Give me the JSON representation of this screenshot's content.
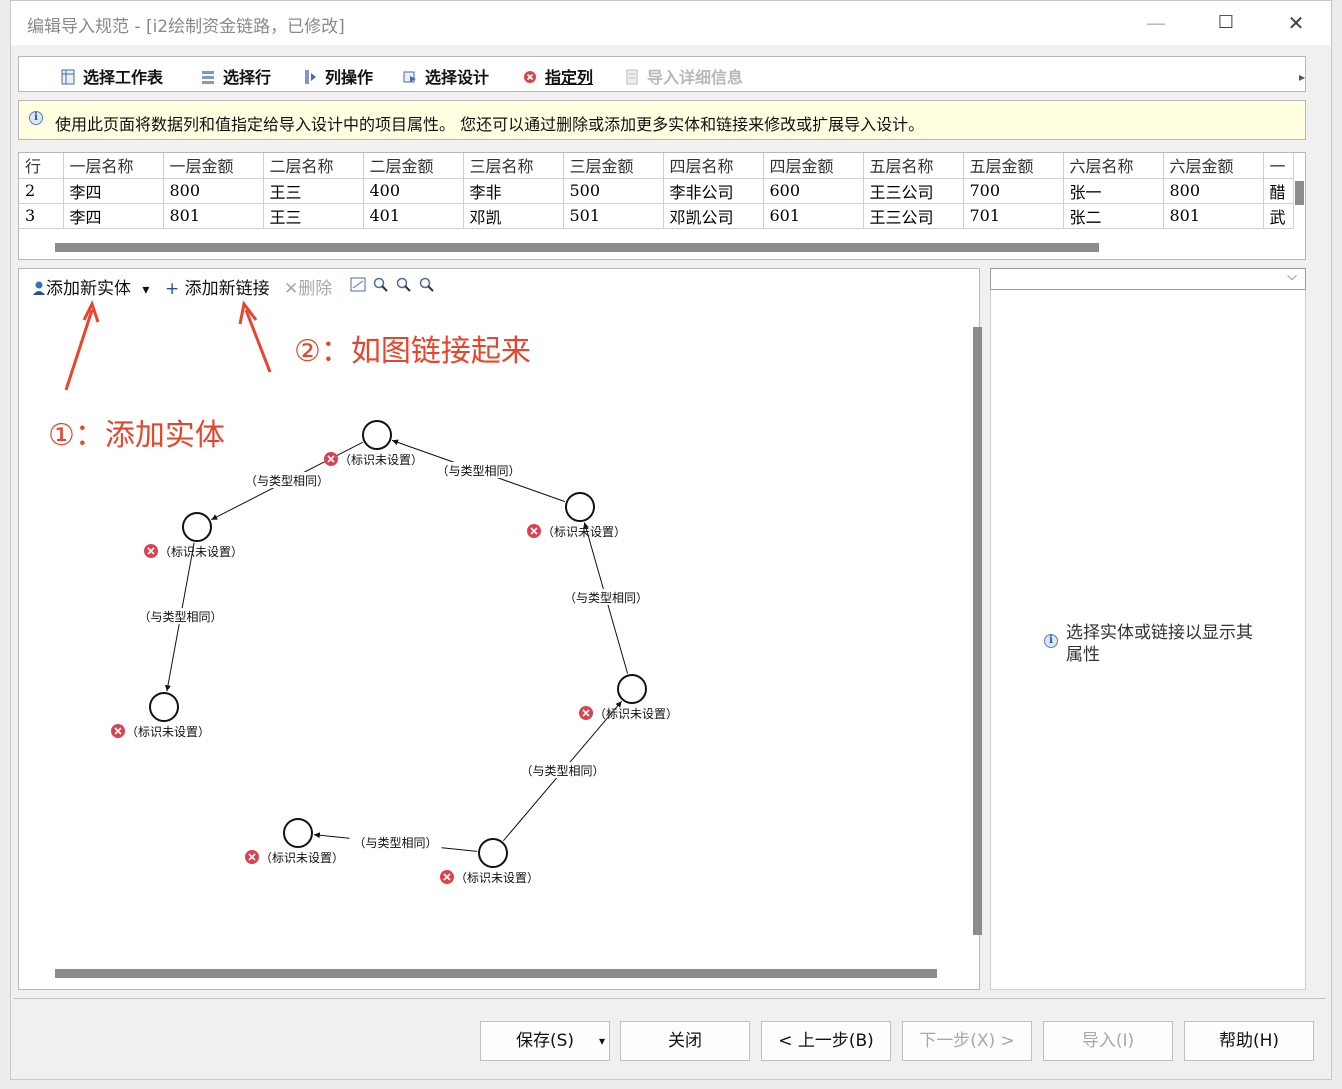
{
  "window": {
    "title": "编辑导入规范 - [i2绘制资金链路，已修改]"
  },
  "window_controls": {
    "minimize": "—",
    "maximize": "☐",
    "close": "✕"
  },
  "tabs": [
    {
      "label": "选择工作表",
      "icon": "worksheet-icon"
    },
    {
      "label": "选择行",
      "icon": "rows-icon"
    },
    {
      "label": "列操作",
      "icon": "column-op-icon"
    },
    {
      "label": "选择设计",
      "icon": "design-icon"
    },
    {
      "label": "指定列",
      "icon": "error-icon",
      "active": true
    },
    {
      "label": "导入详细信息",
      "icon": "details-icon",
      "disabled": true
    }
  ],
  "tab_nav": {
    "left": "◂",
    "right": "▸"
  },
  "info_message": "使用此页面将数据列和值指定给导入设计中的项目属性。 您还可以通过删除或添加更多实体和链接来修改或扩展导入设计。",
  "grid": {
    "headers": [
      "行",
      "一层名称",
      "一层金额",
      "二层名称",
      "二层金额",
      "三层名称",
      "三层金额",
      "四层名称",
      "四层金额",
      "五层名称",
      "五层金额",
      "六层名称",
      "六层金额",
      "一"
    ],
    "rows": [
      [
        "2",
        "李四",
        "800",
        "王三",
        "400",
        "李非",
        "500",
        "李非公司",
        "600",
        "王三公司",
        "700",
        "张一",
        "800",
        "醋"
      ],
      [
        "3",
        "李四",
        "801",
        "王三",
        "401",
        "邓凯",
        "501",
        "邓凯公司",
        "601",
        "王三公司",
        "701",
        "张二",
        "801",
        "武"
      ]
    ]
  },
  "canvas_toolbar": {
    "add_entity": "添加新实体",
    "add_link": "添加新链接",
    "delete": "删除",
    "dropdown_arrow": "▾",
    "plus": "+",
    "delete_icon": "✕"
  },
  "diagram": {
    "node_label": "（标识未设置）",
    "link_label": "（与类型相同）"
  },
  "annotations": {
    "step1": "①：添加实体",
    "step2": "②：如图链接起来",
    "color": "#e8452c"
  },
  "properties": {
    "hint": "选择实体或链接以显示其属性",
    "dropdown_arrow": "⌵"
  },
  "buttons": {
    "save": "保存(S)",
    "save_arrow": "▾",
    "close": "关闭",
    "prev": "< 上一步(B)",
    "next": "下一步(X) >",
    "import": "导入(I)",
    "help": "帮助(H)"
  }
}
